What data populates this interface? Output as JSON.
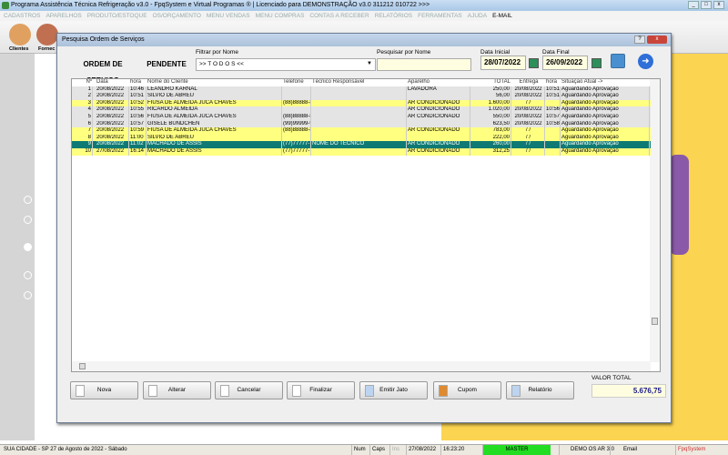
{
  "window": {
    "title": "Programa Assistência Técnica Refrigeração v3.0 - FpqSystem e Virtual Programas ® | Licenciado para  DEMONSTRAÇÃO v3.0 311212 010722 >>>"
  },
  "menu": [
    "CADASTROS",
    "APARELHOS",
    "PRODUTO/ESTOQUE",
    "OS/ORÇAMENTO",
    "MENU VENDAS",
    "MENU COMPRAS",
    "CONTAS A RECEBER",
    "RELATÓRIOS",
    "FERRAMENTAS",
    "AJUDA",
    "E-MAIL"
  ],
  "toolbar": {
    "clientes": "Clientes",
    "fornecedores": "Fornec"
  },
  "dialog": {
    "title": "Pesquisa Ordem de Serviços",
    "tag1": "ORDEM DE SERVIÇO",
    "tag2": "PENDENTE",
    "filter_label": "Filtrar por Nome",
    "filter_value": ">> T O D O S <<",
    "search_label": "Pesquisar por Nome",
    "search_value": "",
    "start_label": "Data Inicial",
    "start_value": "28/07/2022",
    "end_label": "Data Final",
    "end_value": "26/09/2022"
  },
  "grid": {
    "headers": [
      "Nº",
      "Data",
      "hora",
      "Nome do Cliente",
      "Telefone",
      "Técnico Responsável",
      "Aparelho",
      "TOTAL",
      "Entrega",
      "hora",
      "Situação Atual ->"
    ],
    "rows": [
      [
        "1",
        "20/08/2022",
        "10:46",
        "LEANDRO KARNAL",
        "",
        "",
        "LAVADORA",
        "250,00",
        "20/08/2022",
        "10:51",
        "Aguardando Aprovação"
      ],
      [
        "2",
        "20/08/2022",
        "10:51",
        "SILVIO DE ABREU",
        "",
        "",
        "",
        "56,00",
        "20/08/2022",
        "10:51",
        "Aguardando Aprovação"
      ],
      [
        "3",
        "20/08/2022",
        "10:52",
        "FIUSA DE ALMEIDA JUCA CHAVES",
        "(88)88888-8888",
        "",
        "AR CONDICIONADO",
        "1.600,00",
        "/ /",
        "",
        "Aguardando Aprovação"
      ],
      [
        "4",
        "20/08/2022",
        "10:55",
        "RICARDO ALMEIDA",
        "",
        "",
        "AR CONDICIONADO",
        "1.020,00",
        "20/08/2022",
        "10:56",
        "Aguardando Aprovação"
      ],
      [
        "5",
        "20/08/2022",
        "10:56",
        "FIUSA DE ALMEIDA JUCA CHAVES",
        "(88)88888-8888",
        "",
        "AR CONDICIONADO",
        "550,00",
        "20/08/2022",
        "10:57",
        "Aguardando Aprovação"
      ],
      [
        "6",
        "20/08/2022",
        "10:57",
        "GISELE BUNDCHEN",
        "(99)99999-9999",
        "",
        "",
        "623,50",
        "20/08/2022",
        "10:58",
        "Aguardando Aprovação"
      ],
      [
        "7",
        "20/08/2022",
        "10:59",
        "FIUSA DE ALMEIDA JUCA CHAVES",
        "(88)88888-8888",
        "",
        "AR CONDICIONADO",
        "783,00",
        "/ /",
        "",
        "Aguardando Aprovação"
      ],
      [
        "8",
        "20/08/2022",
        "11:00",
        "SILVIO DE ABREU",
        "",
        "",
        "",
        "222,00",
        "/ /",
        "",
        "Aguardando Aprovação"
      ],
      [
        "9",
        "20/08/2022",
        "11:02",
        "MACHADO DE ASSIS",
        "(77)77777-7777",
        "NOME DO TECNICO",
        "AR CONDICIONADO",
        "260,00",
        "/ /",
        "",
        "Aguardando Aprovação"
      ],
      [
        "10",
        "27/08/2022",
        "16:14",
        "MACHADO DE ASSIS",
        "(77)77777-7777",
        "",
        "AR CONDICIONADO",
        "312,25",
        "/ /",
        "",
        "Aguardando Aprovação"
      ]
    ],
    "row_styles": [
      "gray",
      "gray",
      "yellow",
      "gray",
      "gray",
      "gray",
      "yellow",
      "yellow",
      "selected",
      "yellow"
    ]
  },
  "buttons": [
    "Nova",
    "Alterar",
    "Cancelar",
    "Finalizar",
    "Emitir Jato",
    "Cupom",
    "Relatório"
  ],
  "total": {
    "label": "VALOR TOTAL",
    "value": "5.676,75"
  },
  "status": {
    "city": "SUA CIDADE - SP 27 de Agosto de 2022 - Sábado",
    "num": "Num",
    "caps": "Caps",
    "ins": "Ins",
    "date": "27/08/2022",
    "time": "16:23:20",
    "user": "MASTER",
    "version": "DEMO OS AR 3.0",
    "email": "Email",
    "brand": "FpqSystem"
  },
  "colors": {
    "yellow_row": "#ffff80",
    "gray_row": "#e4e4e4",
    "selected_row": "#0f7a73",
    "master": "#22dd22"
  }
}
